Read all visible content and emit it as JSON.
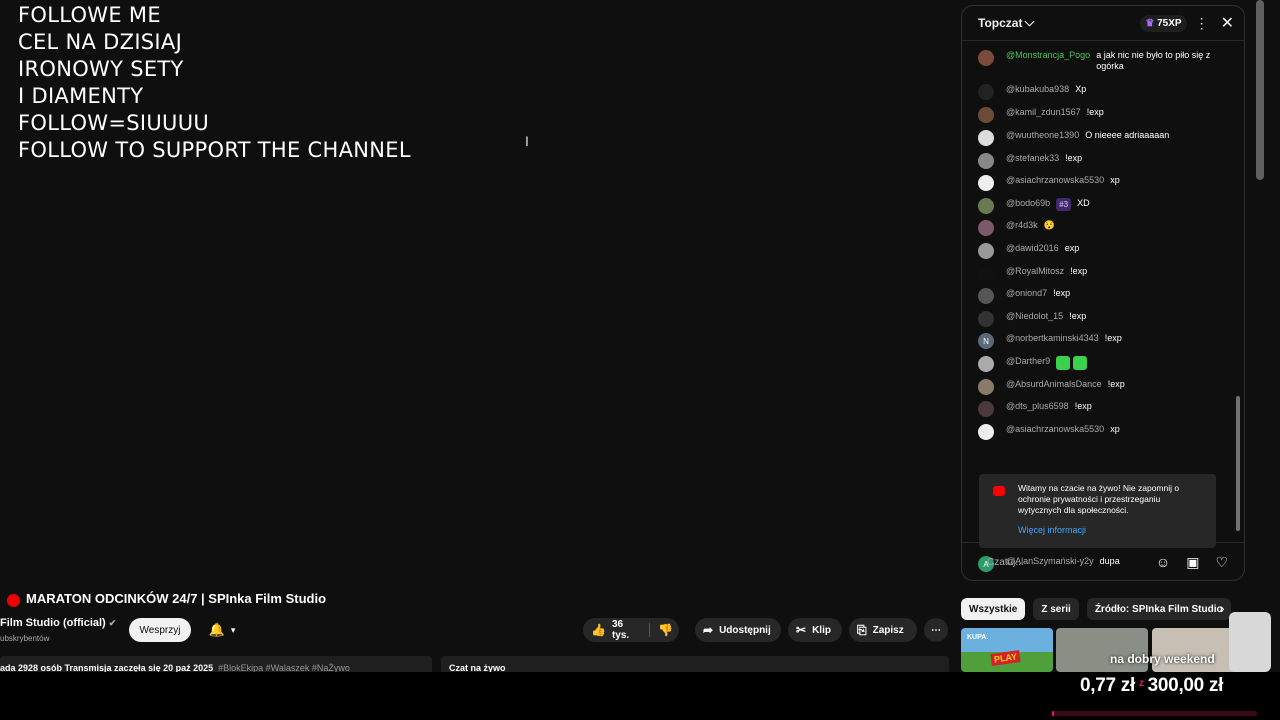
{
  "overlay_lines": [
    "FOLLOWE ME",
    "CEL NA DZISIAJ",
    "IRONOWY SETY",
    "I DIAMENTY",
    "FOLLOW=SIUUUU",
    "FOLLOW TO SUPPORT THE CHANNEL"
  ],
  "chat": {
    "title": "Topczat",
    "xp": "75XP",
    "messages": [
      {
        "author": "@Monstrancja_Pogo",
        "text": "a jak nic nie było to piło się z ogórka",
        "color": "#7a4a3a"
      },
      {
        "author": "@kubakuba938",
        "text": "Xp",
        "color": "#222"
      },
      {
        "author": "@kamil_zdun1567",
        "text": "!exp",
        "color": "#6b4a3a"
      },
      {
        "author": "@wuutheone1390",
        "text": "O nieeee adriaaaaan",
        "color": "#ddd"
      },
      {
        "author": "@stefanek33",
        "text": "!exp",
        "color": "#888"
      },
      {
        "author": "@asiachrzanowska5530",
        "text": "xp",
        "color": "#eee"
      },
      {
        "author": "@bodo69b",
        "text": "XD",
        "badge": "#3",
        "color": "#6a7a50"
      },
      {
        "author": "@r4d3k",
        "text": "😯",
        "color": "#7a5a6a"
      },
      {
        "author": "@dawid2016",
        "text": "exp",
        "color": "#999"
      },
      {
        "author": "@RoyalMitosz",
        "text": "!exp",
        "color": "#111"
      },
      {
        "author": "@oniond7",
        "text": "!exp",
        "color": "#555"
      },
      {
        "author": "@Niedolot_15",
        "text": "!exp",
        "color": "#333"
      },
      {
        "author": "@norbertkaminski4343",
        "text": "!exp",
        "color": "#5a6a7a",
        "letter": "N"
      },
      {
        "author": "@Darther9",
        "text": "",
        "emoji": true,
        "color": "#aaa"
      },
      {
        "author": "@AbsurdAnimalsDance",
        "text": "!exp",
        "color": "#8a7a6a"
      },
      {
        "author": "@dts_plus6598",
        "text": "!exp",
        "color": "#4a3a3a"
      },
      {
        "author": "@asiachrzanowska5530",
        "text": "xp",
        "color": "#eee"
      }
    ],
    "notice_text": "Witamy na czacie na żywo! Nie zapomnij o ochronie prywatności i przestrzeganiu wytycznych dla społeczności.",
    "notice_link": "Więcej informacji",
    "last_message": {
      "author": "@AlanSzymański-y2y",
      "text": "dupa",
      "letter": "A",
      "color": "#2a9d6a"
    },
    "input_placeholder": "Czatuj..."
  },
  "video": {
    "title": "MARATON ODCINKÓW 24/7 | SPInka Film Studio",
    "channel": "Film Studio (official)",
    "subs": "ubskrybentów",
    "support_label": "Wesprzyj",
    "likes": "36 tys.",
    "share": "Udostępnij",
    "clip": "Klip",
    "save": "Zapisz",
    "description": "ada 2928 osób  Transmisja zaczęła się 20 paź 2025",
    "tags": "#BlokEkipa #Walaszek #NaŻywo",
    "chat_label": "Czat na żywo"
  },
  "chips": [
    "Wszystkie",
    "Z serii",
    "Źródło: SPInka Film Studio"
  ],
  "thumb1_label": "KUPA.",
  "thumb1_brand": "PLAY",
  "thumb_caption": "na dobry weekend",
  "donation": {
    "current": "0,77 zł",
    "sep": "z",
    "goal": "300,00 zł",
    "progress": 0.0026
  }
}
